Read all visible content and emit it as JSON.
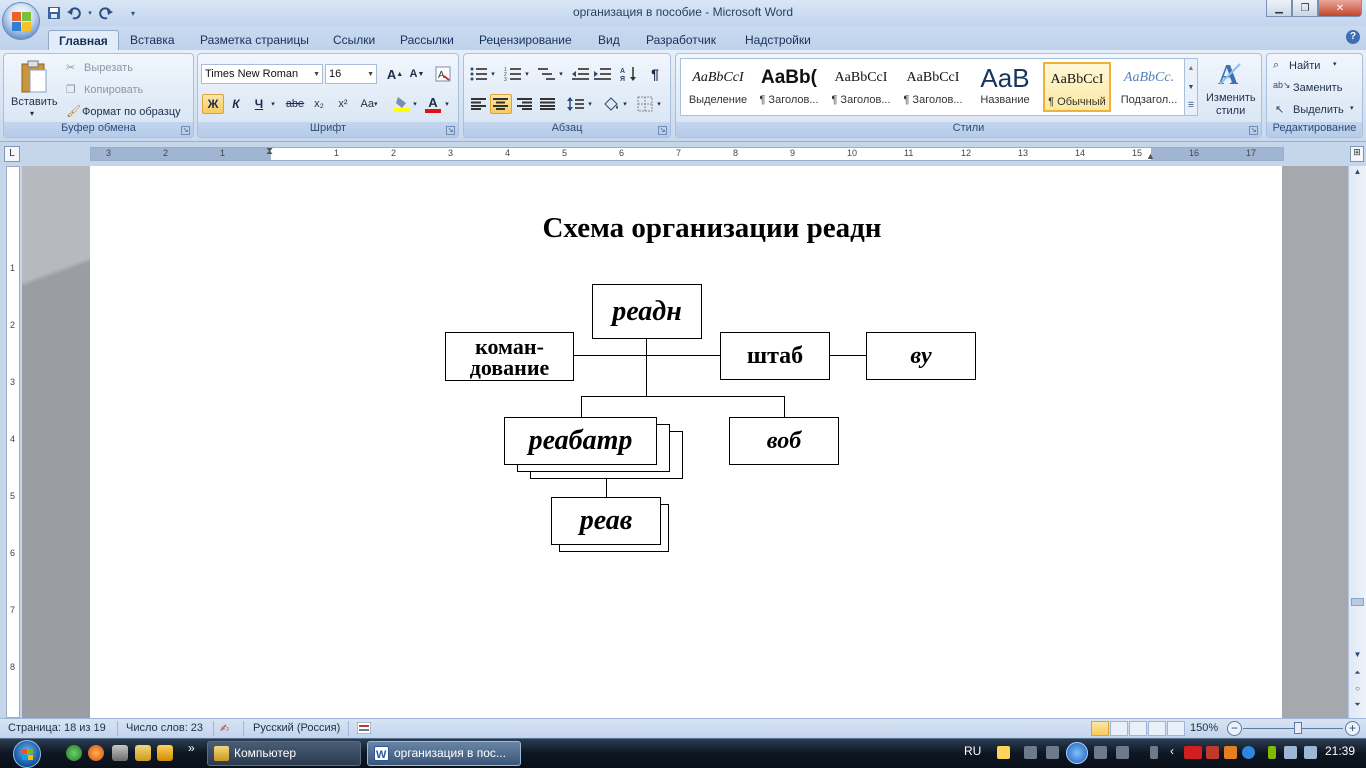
{
  "window": {
    "title": "организация  в пособие - Microsoft Word"
  },
  "qat": {
    "save_icon": "save-icon",
    "undo_icon": "undo-icon",
    "redo_icon": "redo-icon"
  },
  "tabs": [
    "Главная",
    "Вставка",
    "Разметка страницы",
    "Ссылки",
    "Рассылки",
    "Рецензирование",
    "Вид",
    "Разработчик",
    "Надстройки"
  ],
  "ribbon": {
    "clipboard": {
      "label": "Буфер обмена",
      "paste": "Вставить",
      "cut": "Вырезать",
      "copy": "Копировать",
      "format_painter": "Формат по образцу"
    },
    "font": {
      "label": "Шрифт",
      "font_name": "Times New Roman",
      "font_size": "16",
      "bold": "Ж",
      "italic": "К",
      "underline": "Ч",
      "strike": "abe",
      "subscript": "x₂",
      "superscript": "x²",
      "change_case": "Aa",
      "grow": "A",
      "shrink": "A",
      "font_color_letter": "A"
    },
    "paragraph": {
      "label": "Абзац",
      "pilcrow": "¶"
    },
    "styles": {
      "label": "Стили",
      "items": [
        {
          "sample": "AaBbCcI",
          "name": "Выделение"
        },
        {
          "sample": "AaBb(",
          "name": "¶ Заголов..."
        },
        {
          "sample": "AaBbCcI",
          "name": "¶ Заголов..."
        },
        {
          "sample": "AaBbCcI",
          "name": "¶ Заголов..."
        },
        {
          "sample": "AaB",
          "name": "Название"
        },
        {
          "sample": "AaBbCcI",
          "name": "¶ Обычный"
        },
        {
          "sample": "AaBbCc.",
          "name": "Подзагол..."
        }
      ],
      "change_styles_line1": "Изменить",
      "change_styles_line2": "стили"
    },
    "editing": {
      "label": "Редактирование",
      "find": "Найти",
      "replace": "Заменить",
      "select": "Выделить"
    }
  },
  "ruler": {
    "h_ticks": [
      "3",
      "2",
      "1",
      "1",
      "2",
      "3",
      "4",
      "5",
      "6",
      "7",
      "8",
      "9",
      "10",
      "11",
      "12",
      "13",
      "14",
      "15",
      "16",
      "17"
    ],
    "v_ticks": [
      "1",
      "2",
      "3",
      "4",
      "5",
      "6",
      "7",
      "8"
    ]
  },
  "document": {
    "title": "Схема организации реадн",
    "boxes": {
      "top": "реадн",
      "left_line1": "коман-",
      "left_line2": "дование",
      "staff": "штаб",
      "vu": "ву",
      "reabatr": "реабатр",
      "vob": "воб",
      "reav": "реав"
    }
  },
  "statusbar": {
    "page": "Страница: 18 из 19",
    "words": "Число слов: 23",
    "language": "Русский (Россия)",
    "zoom": "150%",
    "zoom_fraction": 0.6
  },
  "taskbar": {
    "windows": [
      {
        "label": "Компьютер"
      },
      {
        "label": "организация  в пос..."
      }
    ],
    "language": "RU",
    "clock": "21:39"
  },
  "colors": {
    "ribbon_bg": "#dbe7f5",
    "tab_active": "#e3edf9",
    "selection_accent": "#f9c95b",
    "taskbar": "#0d1622",
    "font_color_bar": "#e01010",
    "highlight_bar": "#ffff00"
  }
}
